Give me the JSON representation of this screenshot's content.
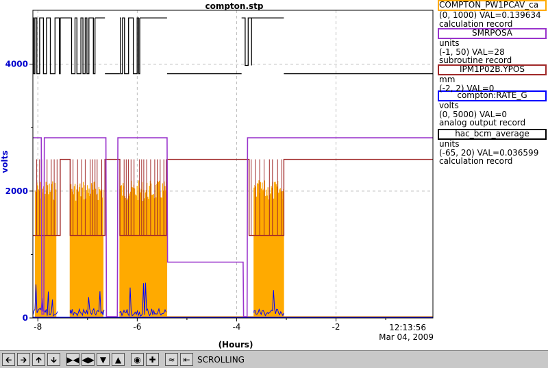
{
  "chart_data": {
    "type": "line",
    "title": "compton.stp",
    "xlabel": "(Hours)",
    "ylabel": "volts",
    "xlim": [
      -8.1,
      -0.05
    ],
    "ylim": [
      0,
      4850
    ],
    "x_ticks": [
      -8,
      -6,
      -4,
      -2
    ],
    "y_ticks": [
      0,
      2000,
      4000
    ],
    "end_time": "12:13:56",
    "end_date": "Mar 04, 2009",
    "grid": true,
    "series": [
      {
        "name": "COMPTON_PW1PCAV_ca",
        "color": "#000000",
        "range": "(0, 1000) VAL=0.139634",
        "record_type": "calculation record",
        "segments": [
          [
            -8.1,
            -7.55,
            3850,
            4730
          ],
          [
            -7.55,
            -7.35,
            4730,
            4730
          ],
          [
            -7.35,
            -6.85,
            3850,
            4730
          ],
          [
            -6.85,
            -6.65,
            4730,
            4730
          ],
          [
            -6.65,
            -6.35,
            3850,
            3850
          ],
          [
            -6.35,
            -5.95,
            3850,
            4730
          ],
          [
            -5.95,
            -5.4,
            4730,
            4730
          ],
          [
            -5.4,
            -3.9,
            3850,
            3850
          ],
          [
            -3.9,
            -3.7,
            3980,
            4730
          ],
          [
            -3.7,
            -3.05,
            4730,
            4730
          ],
          [
            -3.05,
            -0.05,
            3850,
            3850
          ]
        ]
      },
      {
        "name": "SMRPOSA",
        "units": "units",
        "color": "#9933cc",
        "range": "(-1, 50) VAL=28",
        "record_type": "subroutine record",
        "steps": [
          [
            -8.1,
            2840
          ],
          [
            -7.93,
            2840
          ],
          [
            -7.92,
            60
          ],
          [
            -7.88,
            60
          ],
          [
            -7.87,
            2840
          ],
          [
            -6.63,
            2840
          ],
          [
            -6.62,
            20
          ],
          [
            -6.4,
            20
          ],
          [
            -6.39,
            2840
          ],
          [
            -5.4,
            2840
          ],
          [
            -5.39,
            880
          ],
          [
            -3.87,
            880
          ],
          [
            -3.86,
            20
          ],
          [
            -3.79,
            20
          ],
          [
            -3.78,
            2840
          ],
          [
            -0.05,
            2840
          ]
        ]
      },
      {
        "name": "IPM1P02B.YPOS",
        "units": "mm",
        "color": "#a02828",
        "range": "(-2, 2) VAL=0",
        "record_type": "",
        "steps": [
          [
            -8.1,
            1300
          ],
          [
            -7.55,
            1300
          ],
          [
            -7.55,
            2500
          ],
          [
            -7.35,
            2500
          ],
          [
            -7.35,
            1300
          ],
          [
            -6.65,
            1300
          ],
          [
            -6.65,
            2500
          ],
          [
            -6.35,
            2500
          ],
          [
            -6.35,
            1300
          ],
          [
            -5.4,
            1300
          ],
          [
            -5.4,
            2500
          ],
          [
            -3.75,
            2500
          ],
          [
            -3.75,
            1300
          ],
          [
            -3.05,
            1300
          ],
          [
            -3.05,
            2500
          ],
          [
            -0.05,
            2500
          ]
        ]
      },
      {
        "name": "compton:RATE_G",
        "units": "volts",
        "color": "#0000ff",
        "range": "(0, 5000) VAL=0",
        "record_type": "analog output record",
        "noise_blocks": [
          [
            -8.1,
            -7.6,
            0,
            250
          ],
          [
            -7.35,
            -6.65,
            0,
            250
          ],
          [
            -6.35,
            -5.4,
            0,
            250
          ],
          [
            -3.65,
            -3.05,
            0,
            250
          ]
        ]
      },
      {
        "name": "hac_bcm_average",
        "units": "units",
        "color": "#ffaa00",
        "range": "(-65, 20) VAL=0.036599",
        "record_type": "calculation record",
        "noise_blocks": [
          [
            -8.05,
            -7.63,
            0,
            2170
          ],
          [
            -7.35,
            -6.68,
            0,
            2170
          ],
          [
            -6.35,
            -5.4,
            0,
            2170
          ],
          [
            -3.65,
            -3.05,
            0,
            2170
          ]
        ],
        "baseline": 20
      }
    ]
  },
  "toolbar": {
    "mode": "SCROLLING",
    "buttons": [
      "arrow-left",
      "arrow-right",
      "arrow-up",
      "arrow-down",
      "zoom-in-horizontal",
      "zoom-out-horizontal",
      "zoom-in-vertical",
      "zoom-out-vertical",
      "auto-scale",
      "add-trace",
      "time-scale",
      "time-back"
    ]
  }
}
